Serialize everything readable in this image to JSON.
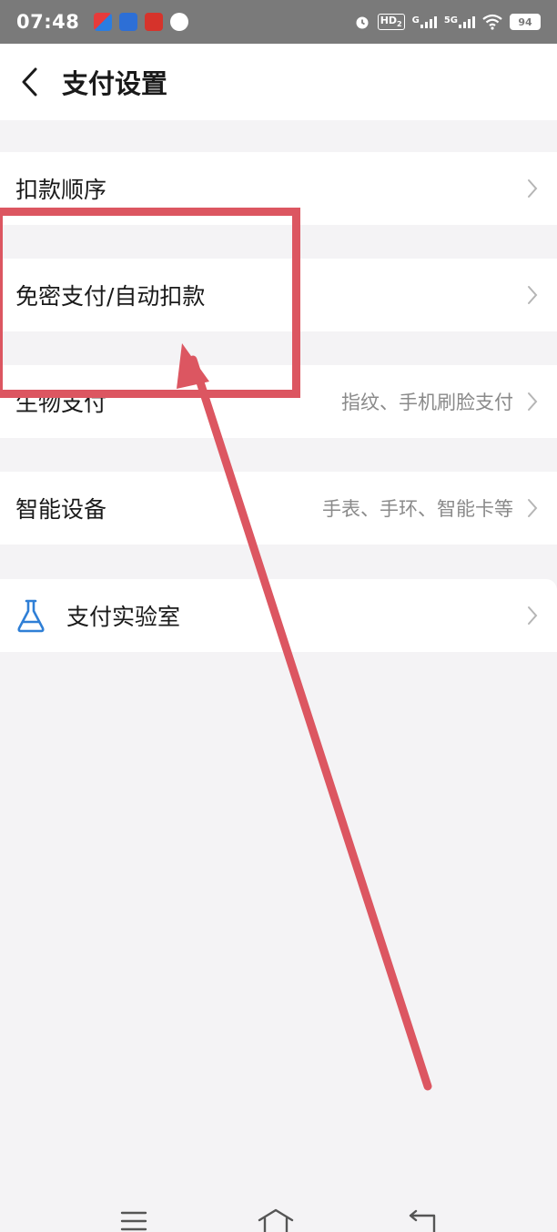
{
  "status_bar": {
    "time": "07:48",
    "hd_label": "HD",
    "hd_sub": "2",
    "network_1": "G",
    "network_2": "5G",
    "battery": "94"
  },
  "header": {
    "title": "支付设置",
    "back_icon": "chevron-left-icon"
  },
  "rows": {
    "deduction_order": {
      "label": "扣款顺序"
    },
    "auto_debit": {
      "label": "免密支付/自动扣款"
    },
    "biometric": {
      "label": "生物支付",
      "value": "指纹、手机刷脸支付"
    },
    "smart_device": {
      "label": "智能设备",
      "value": "手表、手环、智能卡等"
    },
    "payment_lab": {
      "label": "支付实验室",
      "icon": "flask-icon"
    }
  },
  "annotation": {
    "color": "#dc5661"
  },
  "colors": {
    "background": "#f4f3f5",
    "row_bg": "#ffffff",
    "status_bar": "#7a7a7a",
    "lab_icon": "#2f7fd6"
  }
}
